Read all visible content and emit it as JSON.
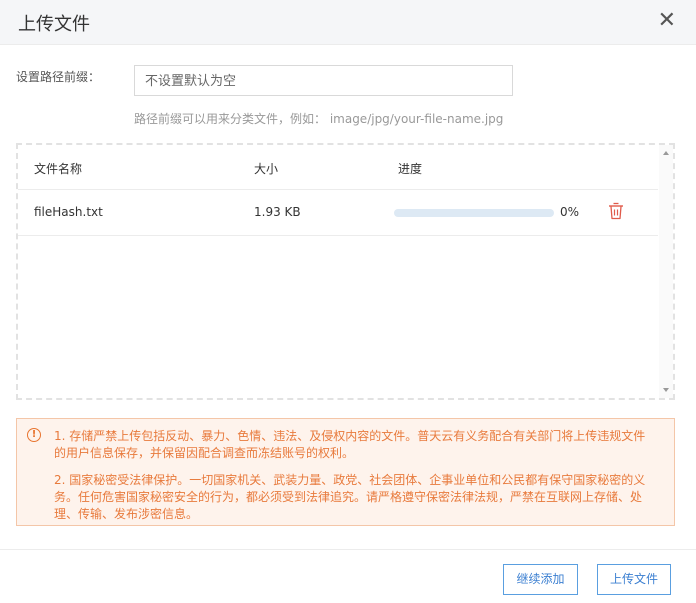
{
  "dialog": {
    "title": "上传文件",
    "close_icon": "close-icon"
  },
  "prefix": {
    "label": "设置路径前缀：",
    "placeholder": "不设置默认为空",
    "value": "",
    "hint": "路径前缀可以用来分类文件，例如：  image/jpg/your-file-name.jpg"
  },
  "table": {
    "columns": [
      "文件名称",
      "大小",
      "进度"
    ],
    "rows": [
      {
        "name": "fileHash.txt",
        "size": "1.93 KB",
        "progress": 0,
        "progress_text": "0%",
        "delete_icon": "trash-icon"
      }
    ]
  },
  "warning": {
    "icon": "exclamation-circle-icon",
    "line1": "1. 存储严禁上传包括反动、暴力、色情、违法、及侵权内容的文件。普天云有义务配合有关部门将上传违规文件的用户信息保存，并保留因配合调查而冻结账号的权利。",
    "line2": "2. 国家秘密受法律保护。一切国家机关、武装力量、政党、社会团体、企事业单位和公民都有保守国家秘密的义务。任何危害国家秘密安全的行为，都必须受到法律追究。请严格遵守保密法律法规，严禁在互联网上存储、处理、传输、发布涉密信息。"
  },
  "footer": {
    "continue_label": "继续添加",
    "upload_label": "上传文件"
  },
  "colors": {
    "accent": "#3b7fd1",
    "warning_text": "#e87a3c",
    "warning_bg": "#fef3ec",
    "delete_icon": "#e05a4a"
  }
}
